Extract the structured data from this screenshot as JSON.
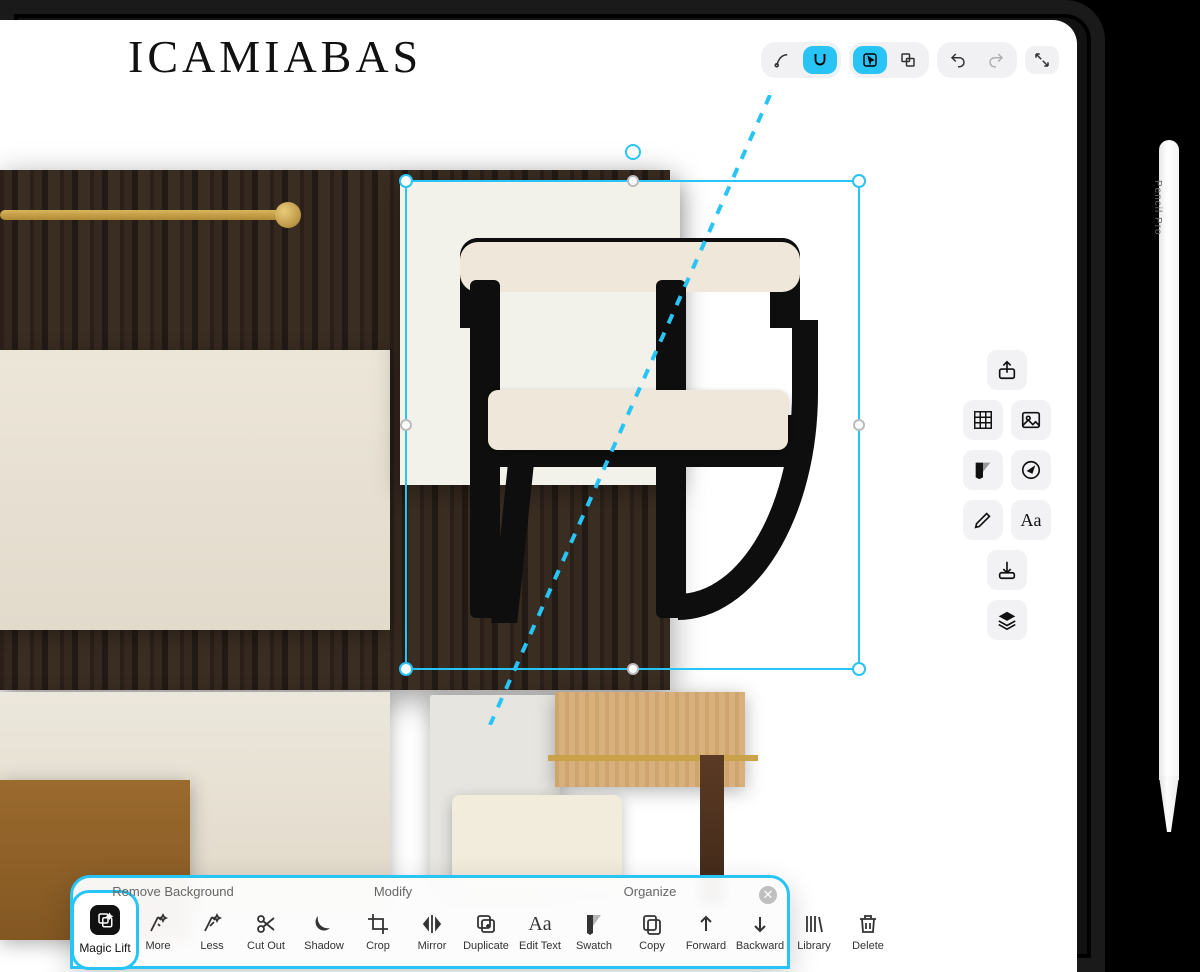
{
  "document": {
    "title": "ICAMIABAS"
  },
  "pencil": {
    "label": "Pencil Pro"
  },
  "topbar": {
    "group1": [
      {
        "name": "pen-pressure-icon",
        "active": false
      },
      {
        "name": "magnet-icon",
        "active": true
      }
    ],
    "group2": [
      {
        "name": "select-tool-icon",
        "active": true
      },
      {
        "name": "transform-icon",
        "active": false
      }
    ],
    "undo": {
      "name": "undo-icon",
      "enabled": true
    },
    "redo": {
      "name": "redo-icon",
      "enabled": false
    },
    "fullscreen": {
      "name": "expand-icon"
    }
  },
  "sidepanel": {
    "share": "share-icon",
    "rows": [
      [
        "grid-icon",
        "image-icon"
      ],
      [
        "swatch-icon",
        "compass-icon"
      ],
      [
        "pencil-draw-icon",
        "text-style-icon"
      ]
    ],
    "import": "import-icon",
    "layers": "layers-icon",
    "text_glyph": "Aa"
  },
  "floatbar": {
    "headers": {
      "remove_bg": "Remove Background",
      "modify": "Modify",
      "organize": "Organize"
    },
    "magic_lift": "Magic Lift",
    "tools_group1": [
      {
        "id": "more",
        "label": "More"
      },
      {
        "id": "less",
        "label": "Less"
      },
      {
        "id": "cutout",
        "label": "Cut Out"
      }
    ],
    "tools_group2": [
      {
        "id": "shadow",
        "label": "Shadow"
      },
      {
        "id": "crop",
        "label": "Crop"
      },
      {
        "id": "mirror",
        "label": "Mirror"
      },
      {
        "id": "duplicate",
        "label": "Duplicate"
      },
      {
        "id": "edittext",
        "label": "Edit Text"
      },
      {
        "id": "swatch",
        "label": "Swatch"
      }
    ],
    "tools_group3": [
      {
        "id": "copy",
        "label": "Copy"
      },
      {
        "id": "forward",
        "label": "Forward"
      },
      {
        "id": "backward",
        "label": "Backward"
      },
      {
        "id": "library",
        "label": "Library"
      },
      {
        "id": "delete",
        "label": "Delete"
      }
    ]
  }
}
